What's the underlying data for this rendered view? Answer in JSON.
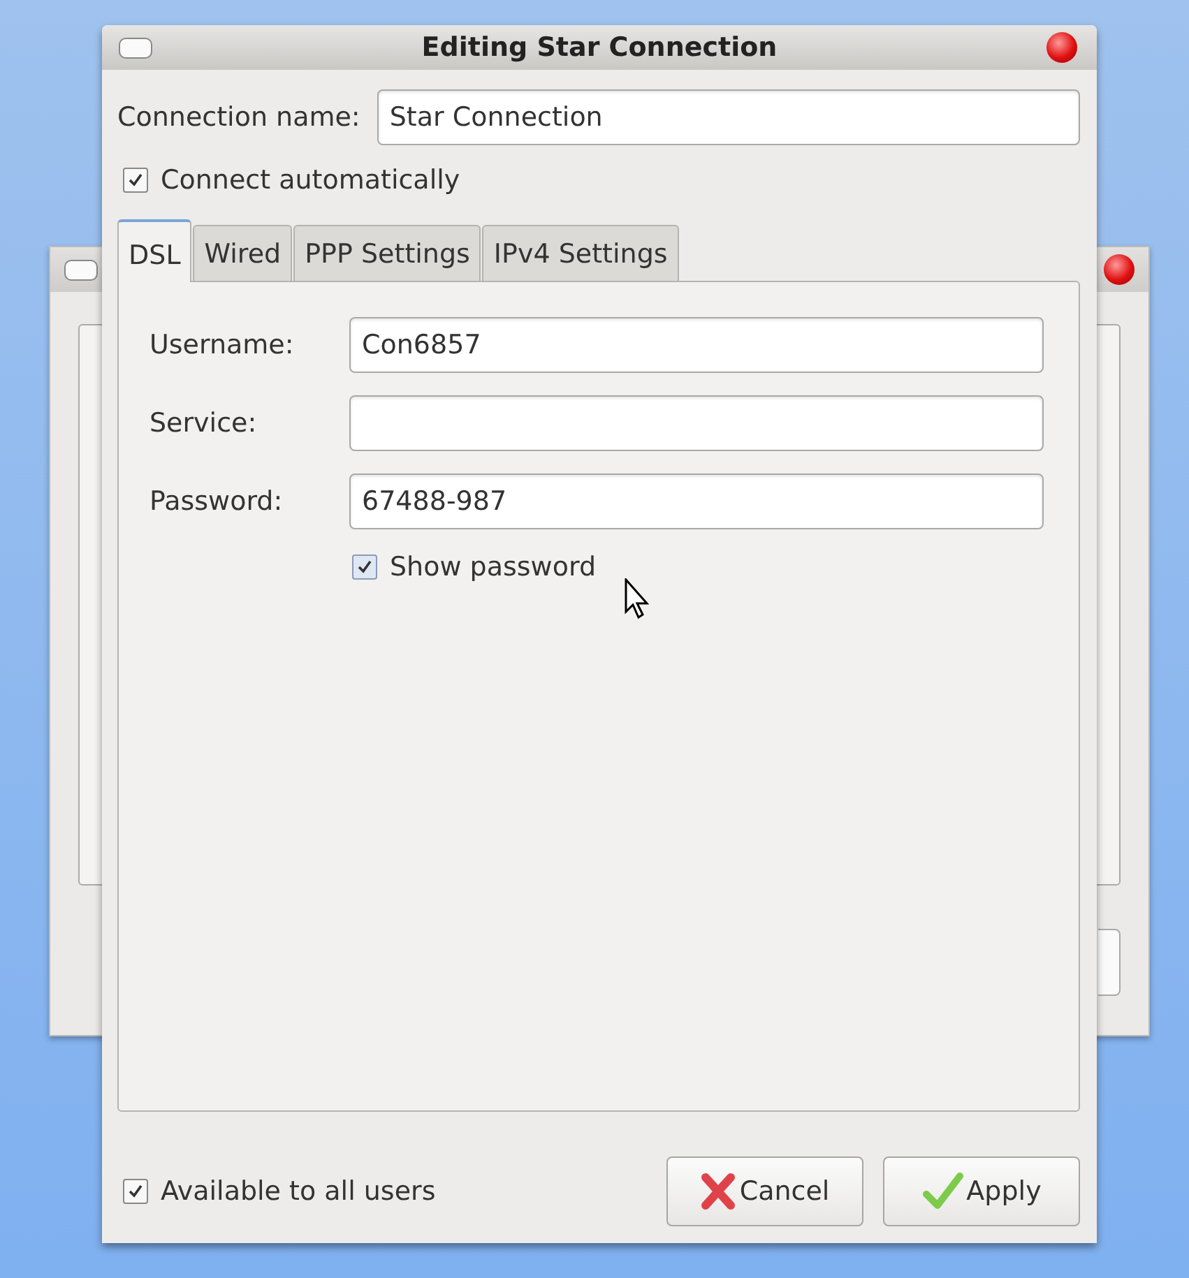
{
  "window": {
    "title": "Editing Star Connection"
  },
  "connection_name": {
    "label": "Connection name:",
    "value": "Star Connection"
  },
  "connect_automatically": {
    "label": "Connect automatically",
    "checked": true
  },
  "tabs": [
    {
      "label": "DSL",
      "selected": true
    },
    {
      "label": "Wired",
      "selected": false
    },
    {
      "label": "PPP Settings",
      "selected": false
    },
    {
      "label": "IPv4 Settings",
      "selected": false
    }
  ],
  "fields": [
    {
      "label": "Username:",
      "value": "Con6857"
    },
    {
      "label": "Service:"
    },
    {
      "label": "Password:",
      "value": "67488-987"
    }
  ],
  "show_password": {
    "label": "Show password",
    "checked": true
  },
  "available_to_all_users": {
    "label": "Available to all users",
    "checked": true
  },
  "buttons": [
    {
      "kind": "cancel",
      "label": "Cancel"
    },
    {
      "kind": "apply",
      "label": "Apply"
    }
  ]
}
